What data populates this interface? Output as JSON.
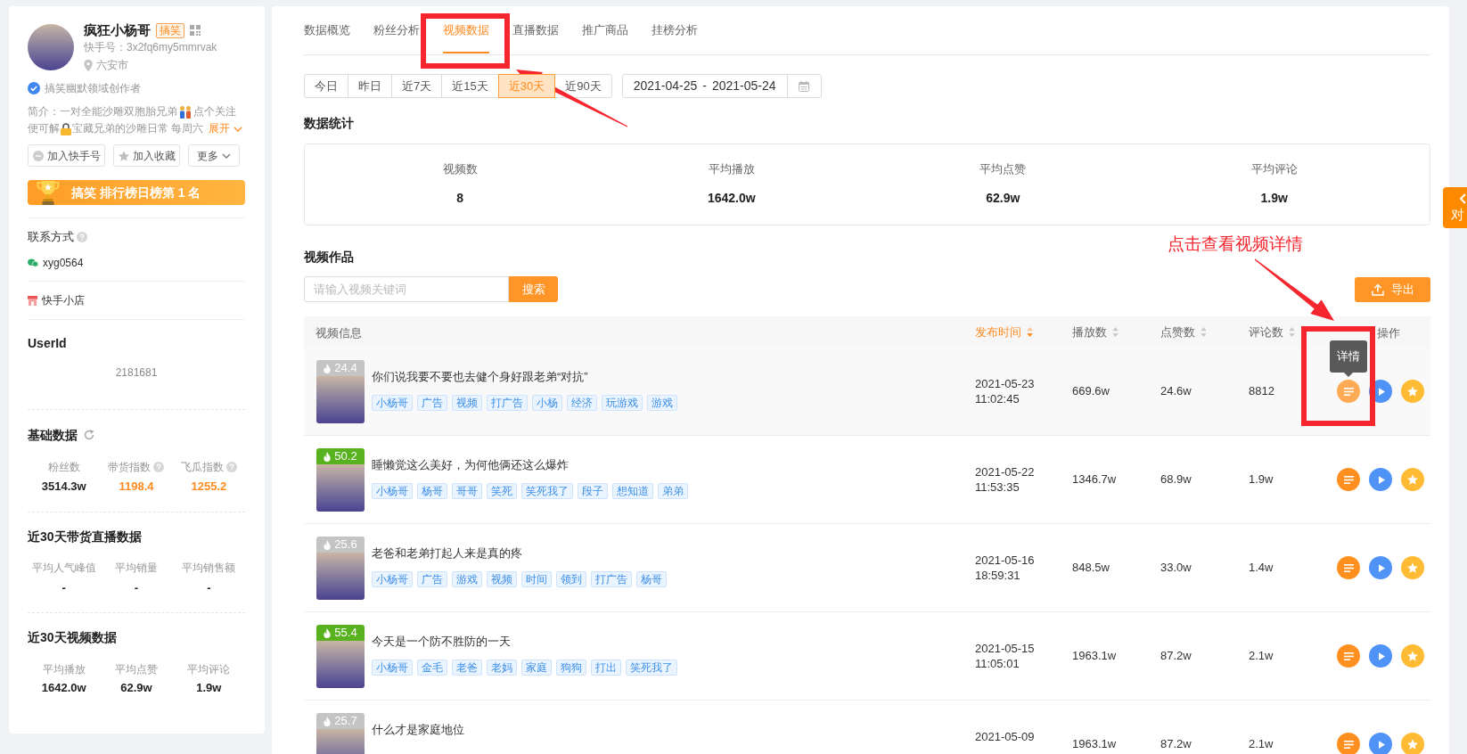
{
  "profile": {
    "name": "疯狂小杨哥",
    "category": "搞笑",
    "account": "快手号：3x2fq6my5mmrvak",
    "location": "六安市",
    "verified": true,
    "certification": "搞笑幽默领域创作者",
    "intro_lines": [
      {
        "before": "简介：一对全能沙雕双胞胎兄弟",
        "after": "点个关注"
      },
      {
        "before": "便可解",
        "after": "宝藏兄弟的沙雕日常 每周六"
      }
    ],
    "expand": "展开",
    "actions": [
      {
        "kind": "follow",
        "label": "加入快手号"
      },
      {
        "kind": "favorite",
        "label": "加入收藏"
      },
      {
        "kind": "more",
        "label": "更多"
      }
    ],
    "rank_banner": "搞笑 排行榜日榜第 1 名"
  },
  "contact": {
    "title": "联系方式",
    "help": true,
    "wechat": "xyg0564"
  },
  "shop": "快手小店",
  "user_id": {
    "title": "UserId",
    "value": "2181681"
  },
  "panels": [
    {
      "title": "基础数据",
      "refreshable": true,
      "items": [
        {
          "label": "粉丝数",
          "value": "3514.3w",
          "help": false,
          "highlight": false
        },
        {
          "label": "带货指数",
          "value": "1198.4",
          "help": true,
          "highlight": true
        },
        {
          "label": "飞瓜指数",
          "value": "1255.2",
          "help": true,
          "highlight": true
        }
      ]
    },
    {
      "title": "近30天带货直播数据",
      "refreshable": false,
      "items": [
        {
          "label": "平均人气峰值",
          "value": "-",
          "help": false,
          "highlight": false
        },
        {
          "label": "平均销量",
          "value": "-",
          "help": false,
          "highlight": false
        },
        {
          "label": "平均销售额",
          "value": "-",
          "help": false,
          "highlight": false
        }
      ]
    },
    {
      "title": "近30天视频数据",
      "refreshable": false,
      "items": [
        {
          "label": "平均播放",
          "value": "1642.0w",
          "help": false,
          "highlight": false
        },
        {
          "label": "平均点赞",
          "value": "62.9w",
          "help": false,
          "highlight": false
        },
        {
          "label": "平均评论",
          "value": "1.9w",
          "help": false,
          "highlight": false
        }
      ]
    }
  ],
  "tabs": [
    {
      "label": "数据概览",
      "selected": false
    },
    {
      "label": "粉丝分析",
      "selected": false
    },
    {
      "label": "视频数据",
      "selected": true
    },
    {
      "label": "直播数据",
      "selected": false
    },
    {
      "label": "推广商品",
      "selected": false
    },
    {
      "label": "挂榜分析",
      "selected": false
    }
  ],
  "date_ranges": [
    {
      "label": "今日",
      "selected": false
    },
    {
      "label": "昨日",
      "selected": false
    },
    {
      "label": "近7天",
      "selected": false
    },
    {
      "label": "近15天",
      "selected": false
    },
    {
      "label": "近30天",
      "selected": true
    },
    {
      "label": "近90天",
      "selected": false
    }
  ],
  "date_picker": {
    "start": "2021-04-25",
    "separator": "-",
    "end": "2021-05-24"
  },
  "summary": {
    "title": "数据统计",
    "items": [
      {
        "label": "视频数",
        "value": "8"
      },
      {
        "label": "平均播放",
        "value": "1642.0w"
      },
      {
        "label": "平均点赞",
        "value": "62.9w"
      },
      {
        "label": "平均评论",
        "value": "1.9w"
      }
    ]
  },
  "videos": {
    "title": "视频作品",
    "search_placeholder": "请输入视频关键词",
    "search_button": "搜索",
    "export_button": "导出",
    "columns": [
      {
        "label": "视频信息",
        "sortable": false,
        "sorted": false
      },
      {
        "label": "发布时间",
        "sortable": true,
        "sorted": true
      },
      {
        "label": "播放数",
        "sortable": true,
        "sorted": false
      },
      {
        "label": "点赞数",
        "sortable": true,
        "sorted": false
      },
      {
        "label": "评论数",
        "sortable": true,
        "sorted": false
      },
      {
        "label": "操作",
        "sortable": false,
        "sorted": false
      }
    ],
    "rows": [
      {
        "heat": "24.4",
        "color": "#c4c4c4",
        "title": "你们说我要不要也去健个身好跟老弟“对抗”",
        "tags": [
          "小杨哥",
          "广告",
          "视频",
          "打广告",
          "小杨",
          "经济",
          "玩游戏",
          "游戏"
        ],
        "date": "2021-05-23",
        "time": "11:02:45",
        "plays": "669.6w",
        "likes": "24.6w",
        "comments": "8812",
        "hovered": true,
        "tooltip": "详情"
      },
      {
        "heat": "50.2",
        "color": "#58b11f",
        "title": "睡懒觉这么美好，为何他俩还这么爆炸",
        "tags": [
          "小杨哥",
          "杨哥",
          "哥哥",
          "笑死",
          "笑死我了",
          "段子",
          "想知道",
          "弟弟"
        ],
        "date": "2021-05-22",
        "time": "11:53:35",
        "plays": "1346.7w",
        "likes": "68.9w",
        "comments": "1.9w",
        "hovered": false
      },
      {
        "heat": "25.6",
        "color": "#c4c4c4",
        "title": "老爸和老弟打起人来是真的疼",
        "tags": [
          "小杨哥",
          "广告",
          "游戏",
          "视频",
          "时间",
          "领到",
          "打广告",
          "杨哥"
        ],
        "date": "2021-05-16",
        "time": "18:59:31",
        "plays": "848.5w",
        "likes": "33.0w",
        "comments": "1.4w",
        "hovered": false
      },
      {
        "heat": "55.4",
        "color": "#58b11f",
        "title": "今天是一个防不胜防的一天",
        "tags": [
          "小杨哥",
          "金毛",
          "老爸",
          "老妈",
          "家庭",
          "狗狗",
          "打出",
          "笑死我了"
        ],
        "date": "2021-05-15",
        "time": "11:05:01",
        "plays": "1963.1w",
        "likes": "87.2w",
        "comments": "2.1w",
        "hovered": false
      },
      {
        "heat": "25.7",
        "color": "#c4c4c4",
        "title": "什么才是家庭地位",
        "date": "2021-05-09",
        "plays": "1963.1w",
        "likes": "87.2w",
        "comments": "2.1w",
        "hovered": false
      }
    ]
  },
  "compare_tab": "对",
  "annotation": "点击查看视频详情"
}
